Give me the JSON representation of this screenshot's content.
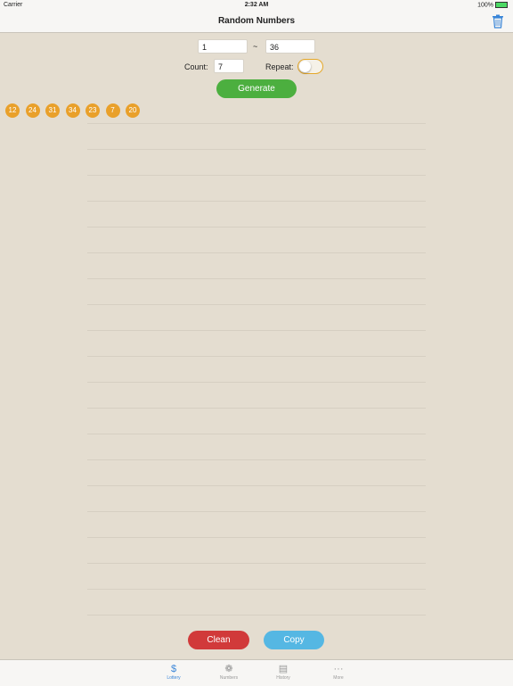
{
  "status_bar": {
    "carrier": "Carrier",
    "time": "2:32 AM",
    "battery": "100%"
  },
  "nav": {
    "title": "Random Numbers",
    "trash_icon": "trash-icon"
  },
  "range": {
    "from": "1",
    "separator": "~",
    "to": "36"
  },
  "count": {
    "label": "Count:",
    "value": "7"
  },
  "repeat": {
    "label": "Repeat:",
    "on": false
  },
  "generate_label": "Generate",
  "results": [
    "12",
    "24",
    "31",
    "34",
    "23",
    "7",
    "20"
  ],
  "actions": {
    "clean_label": "Clean",
    "copy_label": "Copy"
  },
  "tabs": [
    {
      "label": "Lottery",
      "icon": "dollar-icon",
      "active": true
    },
    {
      "label": "Numbers",
      "icon": "wheel-icon",
      "active": false
    },
    {
      "label": "History",
      "icon": "history-icon",
      "active": false
    },
    {
      "label": "More",
      "icon": "more-icon",
      "active": false
    }
  ],
  "colors": {
    "accent_orange": "#e9a02a",
    "generate_green": "#4caf3f",
    "clean_red": "#d13a3a",
    "copy_blue": "#55b7e3",
    "tab_active": "#3a86d8"
  }
}
